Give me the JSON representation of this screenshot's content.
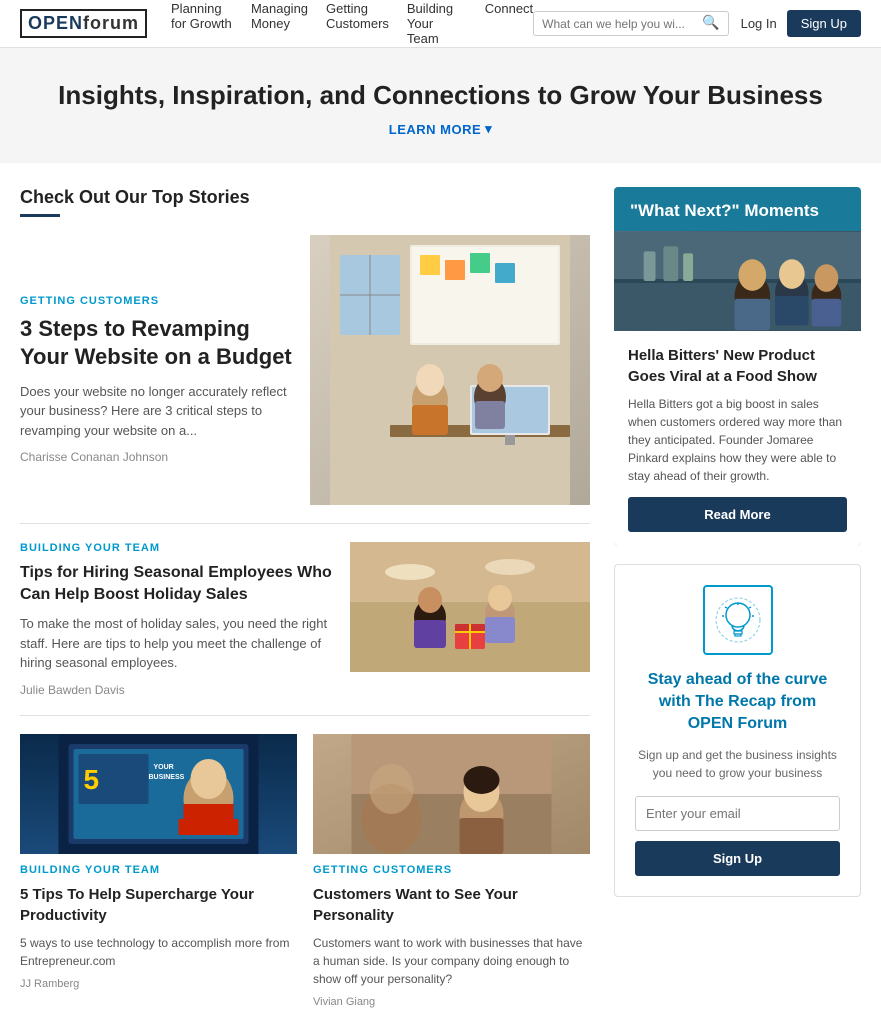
{
  "nav": {
    "logo": "OPEN forum",
    "links": [
      {
        "label": "Planning for Growth",
        "id": "planning"
      },
      {
        "label": "Managing Money",
        "id": "managing"
      },
      {
        "label": "Getting Customers",
        "id": "getting"
      },
      {
        "label": "Building Your Team",
        "id": "building"
      },
      {
        "label": "Connect",
        "id": "connect"
      }
    ],
    "search_placeholder": "What can we help you wi...",
    "login_label": "Log In",
    "signup_label": "Sign Up"
  },
  "hero": {
    "title": "Insights, Inspiration, and Connections to Grow Your Business",
    "learn_more_label": "LEARN MORE"
  },
  "top_stories": {
    "section_title": "Check Out Our Top Stories"
  },
  "story1": {
    "category": "GETTING CUSTOMERS",
    "title": "3 Steps to Revamping Your Website on a Budget",
    "desc": "Does your website no longer accurately reflect your business? Here are 3 critical steps to revamping your website on a...",
    "author": "Charisse Conanan Johnson"
  },
  "story2": {
    "category": "BUILDING YOUR TEAM",
    "title": "Tips for Hiring Seasonal Employees Who Can Help Boost Holiday Sales",
    "desc": "To make the most of holiday sales, you need the right staff. Here are tips to help you meet the challenge of hiring seasonal employees.",
    "author": "Julie Bawden Davis"
  },
  "story3": {
    "category": "BUILDING YOUR TEAM",
    "title": "5 Tips To Help Supercharge Your Productivity",
    "desc": "5 ways to use technology to accomplish more from Entrepreneur.com",
    "author": "JJ Ramberg"
  },
  "story4": {
    "category": "GETTING CUSTOMERS",
    "title": "Customers Want to See Your Personality",
    "desc": "Customers want to work with businesses that have a human side. Is your company doing enough to show off your personality?",
    "author": "Vivian Giang"
  },
  "sidebar": {
    "what_next_label": "\"What Next?\" Moments",
    "hella_title": "Hella Bitters' New Product Goes Viral at a Food Show",
    "hella_desc": "Hella Bitters got a big boost in sales when customers ordered way more than they anticipated. Founder Jomaree Pinkard explains how they were able to stay ahead of their growth.",
    "read_more_label": "Read More",
    "newsletter_title": "Stay ahead of the curve with The Recap from OPEN Forum",
    "newsletter_desc": "Sign up and get the business insights you need to grow your business",
    "newsletter_placeholder": "Enter your email",
    "newsletter_signup_label": "Sign Up"
  }
}
